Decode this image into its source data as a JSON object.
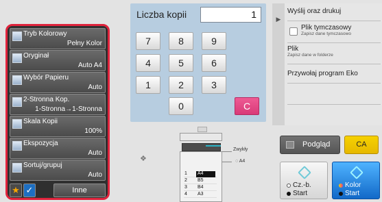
{
  "keypad": {
    "copies_label": "Liczba kopii",
    "copies_value": "1",
    "keys": [
      "7",
      "8",
      "9",
      "4",
      "5",
      "6",
      "1",
      "2",
      "3",
      "0"
    ],
    "clear_label": "C"
  },
  "settings": [
    {
      "label": "Tryb Kolorowy",
      "value": "Pełny Kolor",
      "icon": "color-mode-icon"
    },
    {
      "label": "Oryginał",
      "value": "Auto   A4",
      "icon": "original-icon"
    },
    {
      "label": "Wybór Papieru",
      "value": "Auto",
      "icon": "paper-icon"
    },
    {
      "label": "2-Stronna Kop.",
      "value": "1-Stronna→1-Stronna",
      "icon": "duplex-icon"
    },
    {
      "label": "Skala Kopii",
      "value": "100%",
      "icon": "scale-icon"
    },
    {
      "label": "Ekspozycja",
      "value": "Auto",
      "icon": "exposure-icon"
    },
    {
      "label": "Sortuj/grupuj",
      "value": "Auto",
      "icon": "sort-icon"
    }
  ],
  "bottom": {
    "star": "★",
    "check": "✓",
    "other_label": "Inne"
  },
  "right_panel": {
    "send_print": "Wyślij oraz drukuj",
    "temp_file": "Plik tymczasowy",
    "temp_file_sub": "Zapisz dane tymczasowo",
    "file": "Plik",
    "file_sub": "Zapisz dane w folderze",
    "eco": "Przywołaj program Eko"
  },
  "machine": {
    "paper_type": "Zwykły",
    "bypass_size": "A4",
    "trays": [
      {
        "num": "1",
        "size": "A4",
        "selected": true
      },
      {
        "num": "2",
        "size": "B5",
        "selected": false
      },
      {
        "num": "3",
        "size": "B4",
        "selected": false
      },
      {
        "num": "4",
        "size": "A3",
        "selected": false
      }
    ]
  },
  "actions": {
    "preview": "Podgląd",
    "ca": "CA",
    "bw_start_l1": "Cz.-b.",
    "bw_start_l2": "Start",
    "color_start_l1": "Kolor",
    "color_start_l2": "Start"
  },
  "colors": {
    "accent_red": "#e0233c",
    "clear_key": "#d93a78",
    "color_start": "#1269c8",
    "ca_yellow": "#e6b800"
  }
}
